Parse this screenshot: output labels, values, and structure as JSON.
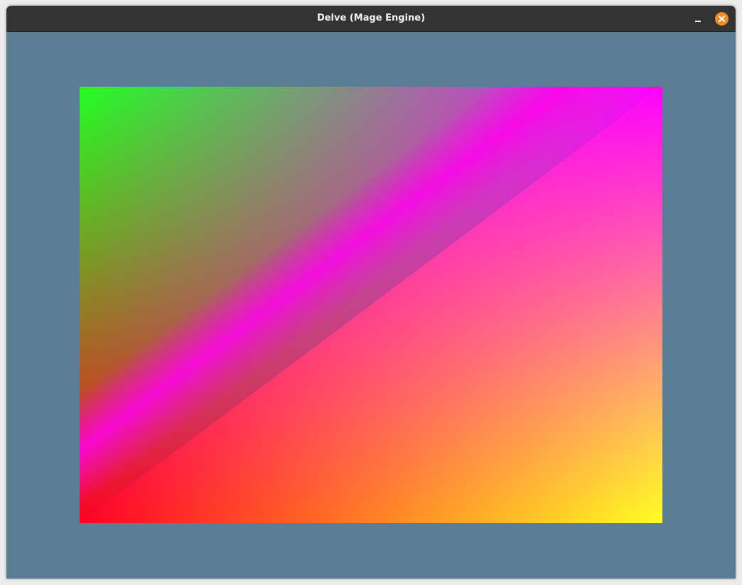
{
  "window": {
    "title": "Delve (Mage Engine)"
  },
  "icons": {
    "minimize": "minimize-icon",
    "close": "close-icon"
  },
  "colors": {
    "titlebar": "#333333",
    "title_text": "#f2f2f2",
    "close_button": "#f08a24",
    "client_background": "#5a7d96",
    "quad_bottom_left": "#ff0022",
    "quad_top_left": "#22ff22",
    "quad_top_right": "#ff00ff",
    "quad_bottom_right": "#ffff22",
    "quad_diagonal": "#ff00ee"
  }
}
